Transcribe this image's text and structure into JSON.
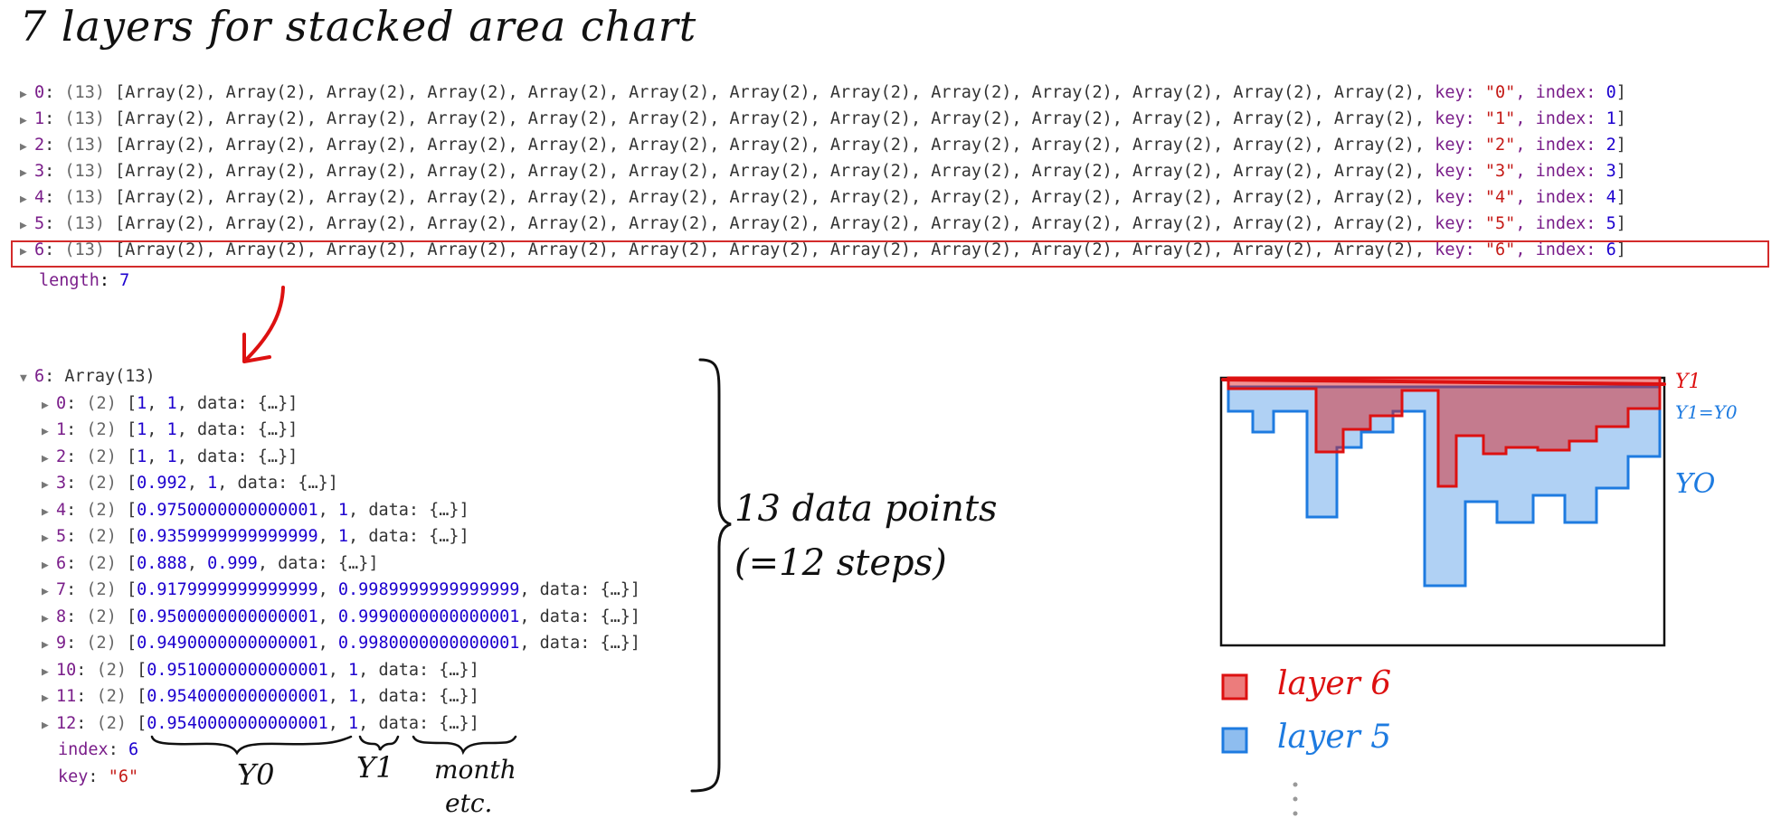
{
  "title": "7 layers for stacked area chart",
  "console": {
    "layers": [
      {
        "index": "0",
        "count": "(13)",
        "items": "[Array(2), Array(2), Array(2), Array(2), Array(2), Array(2), Array(2), Array(2), Array(2), Array(2), Array(2), Array(2), Array(2), ",
        "key_label": "key: ",
        "key": "\"0\"",
        "index_label": ", index: ",
        "index_val": "0",
        "close": "]"
      },
      {
        "index": "1",
        "count": "(13)",
        "items": "[Array(2), Array(2), Array(2), Array(2), Array(2), Array(2), Array(2), Array(2), Array(2), Array(2), Array(2), Array(2), Array(2), ",
        "key_label": "key: ",
        "key": "\"1\"",
        "index_label": ", index: ",
        "index_val": "1",
        "close": "]"
      },
      {
        "index": "2",
        "count": "(13)",
        "items": "[Array(2), Array(2), Array(2), Array(2), Array(2), Array(2), Array(2), Array(2), Array(2), Array(2), Array(2), Array(2), Array(2), ",
        "key_label": "key: ",
        "key": "\"2\"",
        "index_label": ", index: ",
        "index_val": "2",
        "close": "]"
      },
      {
        "index": "3",
        "count": "(13)",
        "items": "[Array(2), Array(2), Array(2), Array(2), Array(2), Array(2), Array(2), Array(2), Array(2), Array(2), Array(2), Array(2), Array(2), ",
        "key_label": "key: ",
        "key": "\"3\"",
        "index_label": ", index: ",
        "index_val": "3",
        "close": "]"
      },
      {
        "index": "4",
        "count": "(13)",
        "items": "[Array(2), Array(2), Array(2), Array(2), Array(2), Array(2), Array(2), Array(2), Array(2), Array(2), Array(2), Array(2), Array(2), ",
        "key_label": "key: ",
        "key": "\"4\"",
        "index_label": ", index: ",
        "index_val": "4",
        "close": "]"
      },
      {
        "index": "5",
        "count": "(13)",
        "items": "[Array(2), Array(2), Array(2), Array(2), Array(2), Array(2), Array(2), Array(2), Array(2), Array(2), Array(2), Array(2), Array(2), ",
        "key_label": "key: ",
        "key": "\"5\"",
        "index_label": ", index: ",
        "index_val": "5",
        "close": "]"
      },
      {
        "index": "6",
        "count": "(13)",
        "items": "[Array(2), Array(2), Array(2), Array(2), Array(2), Array(2), Array(2), Array(2), Array(2), Array(2), Array(2), Array(2), Array(2), ",
        "key_label": "key: ",
        "key": "\"6\"",
        "index_label": ", index: ",
        "index_val": "6",
        "close": "]"
      }
    ],
    "length_label": "length",
    "length_value": "7"
  },
  "expanded": {
    "header_index": "6",
    "header_type": "Array(13)",
    "points": [
      {
        "i": "0",
        "y0": "1",
        "y1": "1"
      },
      {
        "i": "1",
        "y0": "1",
        "y1": "1"
      },
      {
        "i": "2",
        "y0": "1",
        "y1": "1"
      },
      {
        "i": "3",
        "y0": "0.992",
        "y1": "1"
      },
      {
        "i": "4",
        "y0": "0.9750000000000001",
        "y1": "1"
      },
      {
        "i": "5",
        "y0": "0.9359999999999999",
        "y1": "1"
      },
      {
        "i": "6",
        "y0": "0.888",
        "y1": "0.999"
      },
      {
        "i": "7",
        "y0": "0.9179999999999999",
        "y1": "0.9989999999999999"
      },
      {
        "i": "8",
        "y0": "0.9500000000000001",
        "y1": "0.9990000000000001"
      },
      {
        "i": "9",
        "y0": "0.9490000000000001",
        "y1": "0.9980000000000001"
      },
      {
        "i": "10",
        "y0": "0.9510000000000001",
        "y1": "1"
      },
      {
        "i": "11",
        "y0": "0.9540000000000001",
        "y1": "1"
      },
      {
        "i": "12",
        "y0": "0.9540000000000001",
        "y1": "1"
      }
    ],
    "count_label": "(2)",
    "data_text": "data: {…}",
    "index_label": "index",
    "index_value": "6",
    "key_label": "key",
    "key_value": "\"6\""
  },
  "annotations": {
    "data_points": "13 data points",
    "steps": "(=12 steps)",
    "y0": "Y0",
    "y1": "Y1",
    "month_etc_1": "month",
    "month_etc_2": "etc.",
    "legend_layer6": "layer 6",
    "legend_layer5": "layer 5",
    "sketch_y1": "Y1",
    "sketch_y1_eq": "Y1=Y0",
    "sketch_y0": "YO"
  },
  "colors": {
    "red": "#d11",
    "blue": "#1e7be0"
  }
}
